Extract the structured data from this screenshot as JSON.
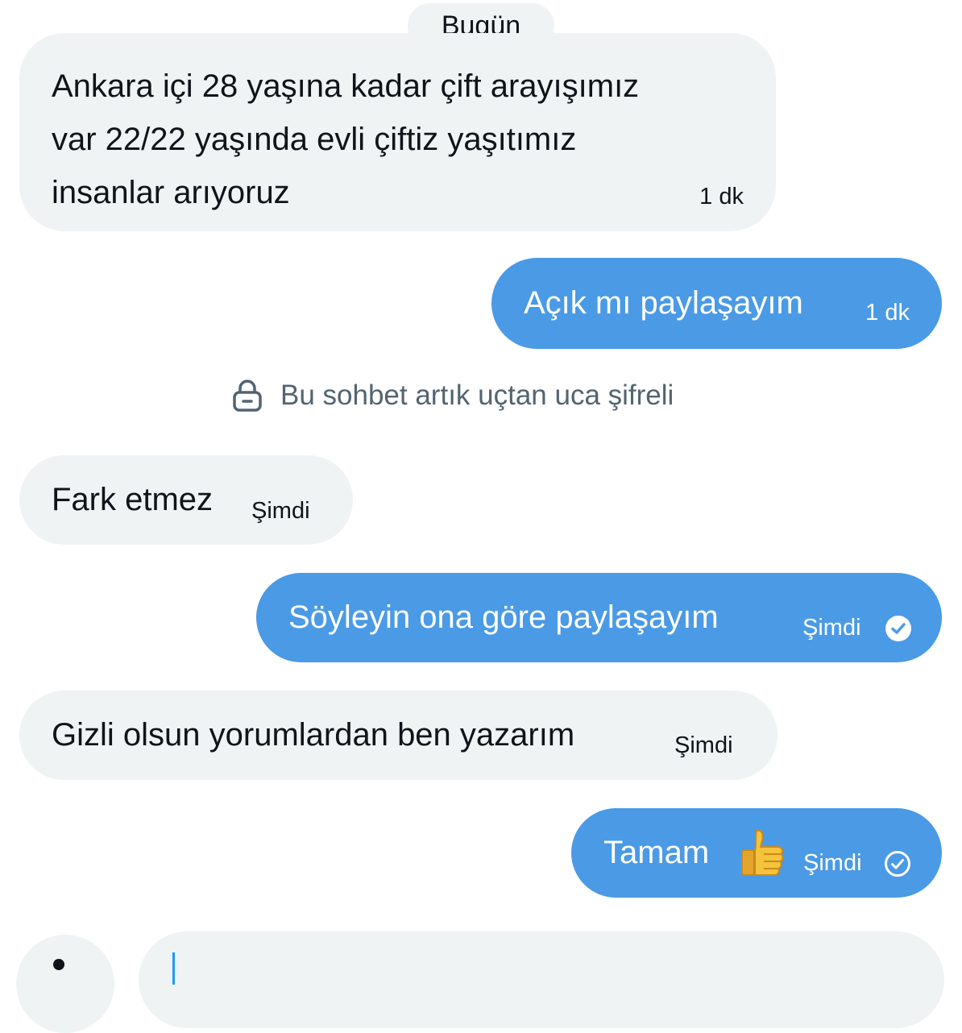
{
  "date_divider": "Bugün",
  "messages": [
    {
      "direction": "incoming",
      "text": "Ankara içi 28 yaşına kadar çift arayışımız\nvar 22/22 yaşında evli çiftiz yaşıtımız\ninsanlar arıyoruz",
      "time": "1 dk"
    },
    {
      "direction": "outgoing",
      "text": "Açık mı paylaşayım",
      "time": "1 dk"
    },
    {
      "direction": "incoming",
      "text": "Fark etmez",
      "time": "Şimdi"
    },
    {
      "direction": "outgoing",
      "text": "Söyleyin ona göre paylaşayım",
      "time": "Şimdi",
      "status_icon": "check-filled-icon"
    },
    {
      "direction": "incoming",
      "text": "Gizli olsun yorumlardan ben yazarım",
      "time": "Şimdi"
    },
    {
      "direction": "outgoing",
      "text": "Tamam",
      "emoji": "thumbs-up-emoji",
      "time": "Şimdi",
      "status_icon": "check-outline-icon"
    }
  ],
  "encryption_notice": {
    "icon": "lock-icon",
    "text": "Bu sohbet artık uçtan uca şifreli"
  },
  "composer": {
    "input_value": ""
  },
  "colors": {
    "incoming_bubble": "#eff3f4",
    "outgoing_bubble": "#4a9ae6",
    "text": "#0f1419",
    "muted": "#536471",
    "accent": "#1d9bf0"
  }
}
